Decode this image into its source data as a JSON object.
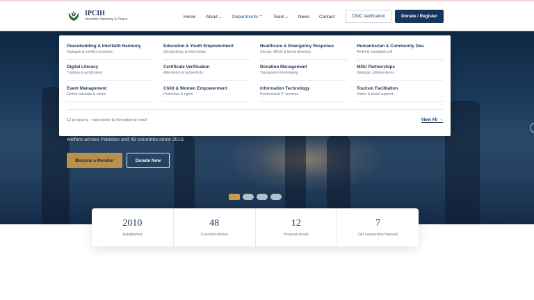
{
  "brand": {
    "name": "IPCIH",
    "tagline": "Interfaith Harmony & Peace"
  },
  "nav": {
    "home": "Home",
    "about": "About",
    "departments": "Departments",
    "team": "Team",
    "news": "News",
    "contact": "Contact",
    "cnic_button": "CNIC Verification",
    "donate_button": "Donate / Register"
  },
  "mega_menu": {
    "items": [
      {
        "title": "Peacebuilding & Interfaith Harmony",
        "desc": "Dialogue & conflict resolution"
      },
      {
        "title": "Education & Youth Empowerment",
        "desc": "Scholarships & internships"
      },
      {
        "title": "Healthcare & Emergency Response",
        "desc": "Camps, BHUs & blood directory"
      },
      {
        "title": "Humanitarian & Community Dev.",
        "desc": "Relief & complaint cell"
      },
      {
        "title": "Digital Literacy",
        "desc": "Training & certification"
      },
      {
        "title": "Certificate Verification",
        "desc": "Attestation & authenticity"
      },
      {
        "title": "Donation Management",
        "desc": "Transparent fundraising"
      },
      {
        "title": "MOU Partnerships",
        "desc": "Strategic collaborations"
      },
      {
        "title": "Event Management",
        "desc": "Global calendar & rallies"
      },
      {
        "title": "Child & Women Empowerment",
        "desc": "Protection & rights"
      },
      {
        "title": "Information Technology",
        "desc": "Professional IT services"
      },
      {
        "title": "Tourism Facilitation",
        "desc": "Visitor & travel support"
      }
    ],
    "footer_text": "12 programs · nationwide & international reach",
    "view_all": "View All →"
  },
  "hero": {
    "subtitle": "welfare across Pakistan and 48 countries since 2010.",
    "member_button": "Become a Member",
    "donate_button": "Donate Now",
    "slides_total": 4,
    "slide_active": 1
  },
  "stats": [
    {
      "value": "2010",
      "label": "Established"
    },
    {
      "value": "48",
      "label": "Countries Active"
    },
    {
      "value": "12",
      "label": "Program Areas"
    },
    {
      "value": "7",
      "label": "Tier Leadership Network"
    }
  ],
  "colors": {
    "primary": "#16375d",
    "accent": "#b8924b",
    "hero": "#1b3a5c"
  },
  "icons": {
    "logo": "emblem-icon",
    "caret": "chevron-down-icon",
    "caret_up": "chevron-up-icon",
    "next": "next-slide-icon"
  }
}
